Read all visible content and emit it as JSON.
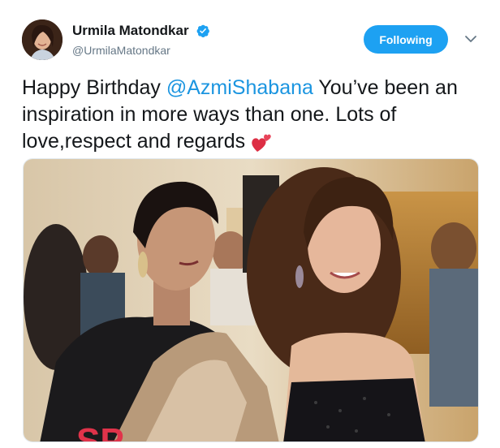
{
  "tweet": {
    "author_name": "Urmila Matondkar",
    "author_handle": "@UrmilaMatondkar",
    "verified": true,
    "follow_label": "Following",
    "text_before": "Happy Birthday ",
    "mention": "@AzmiShabana",
    "text_after": " You’ve been an inspiration in more ways than one. Lots of love,respect and regards "
  },
  "icons": {
    "verified": "verified-badge-icon",
    "more": "chevron-down-icon",
    "emoji": "two-hearts-emoji-icon"
  },
  "colors": {
    "accent": "#1da1f2",
    "mention": "#1b95e0",
    "secondary_text": "#657786"
  },
  "photo": {
    "logo_text": "SP"
  }
}
